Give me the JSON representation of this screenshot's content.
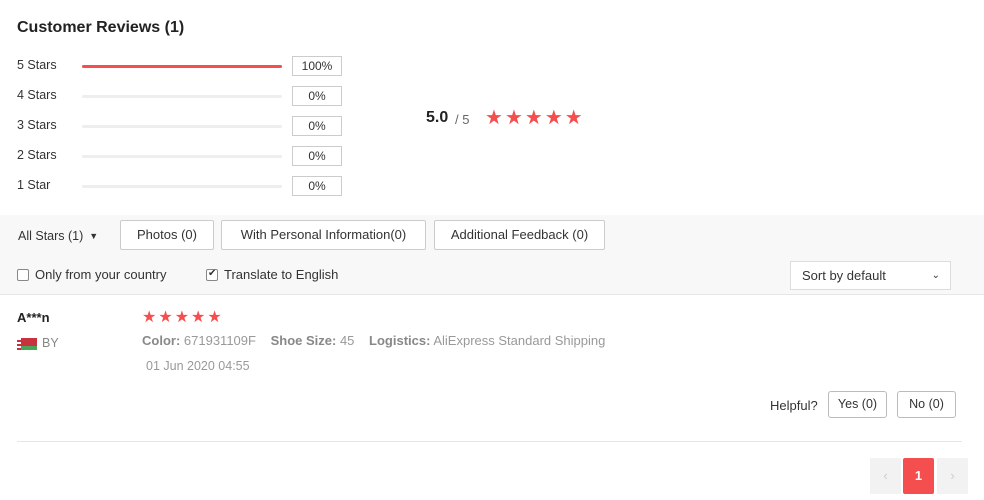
{
  "header": {
    "title": "Customer Reviews (1)"
  },
  "distribution": [
    {
      "label": "5 Stars",
      "fraction": 1.0,
      "pct": "100%"
    },
    {
      "label": "4 Stars",
      "fraction": 0,
      "pct": "0%"
    },
    {
      "label": "3 Stars",
      "fraction": 0,
      "pct": "0%"
    },
    {
      "label": "2 Stars",
      "fraction": 0,
      "pct": "0%"
    },
    {
      "label": "1 Star",
      "fraction": 0,
      "pct": "0%"
    }
  ],
  "summary": {
    "average": "5.0",
    "out_of": "/ 5",
    "stars": 5
  },
  "filters": {
    "all_stars": "All Stars (1)",
    "photos": "Photos (0)",
    "personal": "With Personal Information(0)",
    "additional": "Additional Feedback (0)",
    "only_country": {
      "label": "Only from your country",
      "checked": false
    },
    "translate": {
      "label": "Translate to English",
      "checked": true
    },
    "sort": "Sort by default"
  },
  "review": {
    "user": "A***n",
    "country": "BY",
    "stars": 5,
    "color_label": "Color:",
    "color_value": "671931109F",
    "size_label": "Shoe Size:",
    "size_value": "45",
    "logistics_label": "Logistics:",
    "logistics_value": "AliExpress Standard Shipping",
    "date": "01 Jun 2020 04:55",
    "helpful_label": "Helpful?",
    "yes": "Yes (0)",
    "no": "No (0)"
  },
  "pagination": {
    "prev": "‹",
    "current": "1",
    "next": "›"
  },
  "colors": {
    "accent": "#f44e4e"
  }
}
